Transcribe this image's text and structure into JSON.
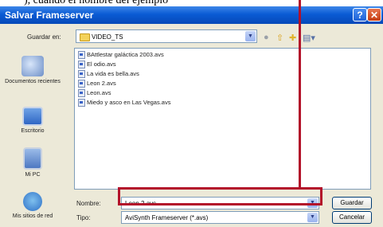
{
  "caption": {
    "text": "), cuando el nombre del ejemplo"
  },
  "window": {
    "title": "Salvar Frameserver"
  },
  "save_in": {
    "label": "Guardar en:",
    "value": "VIDEO_TS"
  },
  "toolbar": {
    "icons": [
      "back-icon",
      "up-folder-icon",
      "new-folder-icon",
      "view-menu-icon"
    ]
  },
  "places": [
    {
      "label": "Documentos recientes",
      "icon": "recent-documents-icon"
    },
    {
      "label": "Escritorio",
      "icon": "desktop-icon"
    },
    {
      "label": "Mi PC",
      "icon": "my-computer-icon"
    },
    {
      "label": "Mis sitios de red",
      "icon": "network-places-icon"
    }
  ],
  "files": [
    "BAttlestar galáctica 2003.avs",
    "El odio.avs",
    "La vida es bella.avs",
    "Leon 2.avs",
    "Leon.avs",
    "Miedo y asco en Las Vegas.avs"
  ],
  "filename": {
    "label": "Nombre:",
    "value": "Leon 2.avs"
  },
  "filetype": {
    "label": "Tipo:",
    "value": "AviSynth Frameserver (*.avs)"
  },
  "buttons": {
    "save": "Guardar",
    "cancel": "Cancelar"
  },
  "colors": {
    "titlebar": "#0a5bd4",
    "dialog_bg": "#ece9d8",
    "highlight": "#b3112a"
  }
}
